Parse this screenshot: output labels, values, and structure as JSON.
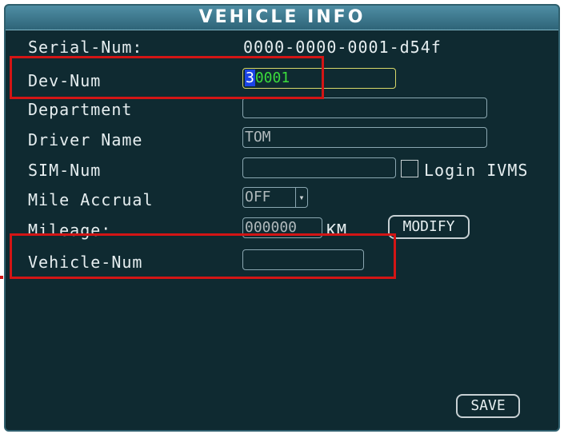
{
  "window": {
    "title": "VEHICLE INFO"
  },
  "labels": {
    "serial": "Serial-Num:",
    "dev": "Dev-Num",
    "department": "Department",
    "driver": "Driver Name",
    "sim": "SIM-Num",
    "mile_accrual": "Mile Accrual",
    "mileage": "Mileage:",
    "vehicle": "Vehicle-Num"
  },
  "values": {
    "serial": "0000-0000-0001-d54f",
    "dev_cursor": "3",
    "dev_rest": "0001",
    "department": "",
    "driver": "TOM",
    "sim": "",
    "mile_accrual": "OFF",
    "mileage": "000000",
    "mileage_unit": "KM",
    "vehicle": ""
  },
  "checkbox": {
    "label": "Login IVMS"
  },
  "buttons": {
    "modify": "MODIFY",
    "save": "SAVE"
  },
  "icons": {
    "dropdown": "chevron-down-icon",
    "checkbox": "checkbox-icon"
  },
  "colors": {
    "highlight": "#d31515",
    "accent_active_field": "#d8d86a",
    "dev_value": "#3bdc3b",
    "cursor_bg": "#1b44e6"
  }
}
